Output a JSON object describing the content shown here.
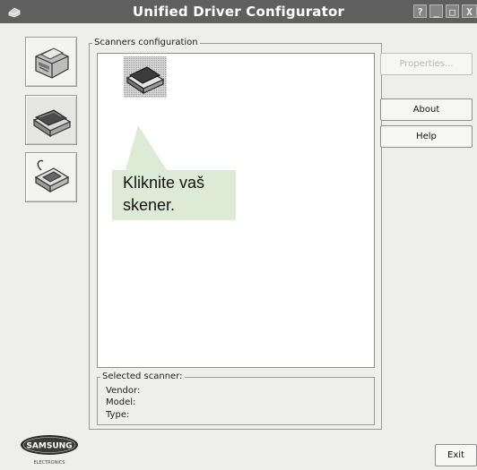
{
  "window": {
    "title": "Unified Driver Configurator",
    "controls": {
      "help": "?",
      "minimize": "_",
      "maximize": "□",
      "close": "X"
    }
  },
  "sidebar": {
    "items": [
      {
        "name": "printers-configuration",
        "icon": "printer-icon",
        "active": false
      },
      {
        "name": "scanners-configuration",
        "icon": "scanner-icon",
        "active": true
      },
      {
        "name": "ports-configuration",
        "icon": "port-icon",
        "active": false
      }
    ]
  },
  "scanners_group": {
    "label": "Scanners configuration",
    "selected_icon": "flatbed-scanner-icon"
  },
  "callout": {
    "line1": "Kliknite vaš",
    "line2": "skener."
  },
  "buttons": {
    "properties": "Properties...",
    "about": "About",
    "help": "Help",
    "exit": "Exit"
  },
  "selected_scanner": {
    "label": "Selected scanner:",
    "vendor_label": "Vendor:",
    "model_label": "Model:",
    "type_label": "Type:"
  },
  "logo": {
    "brand": "SAMSUNG",
    "sub": "ELECTRONICS"
  }
}
